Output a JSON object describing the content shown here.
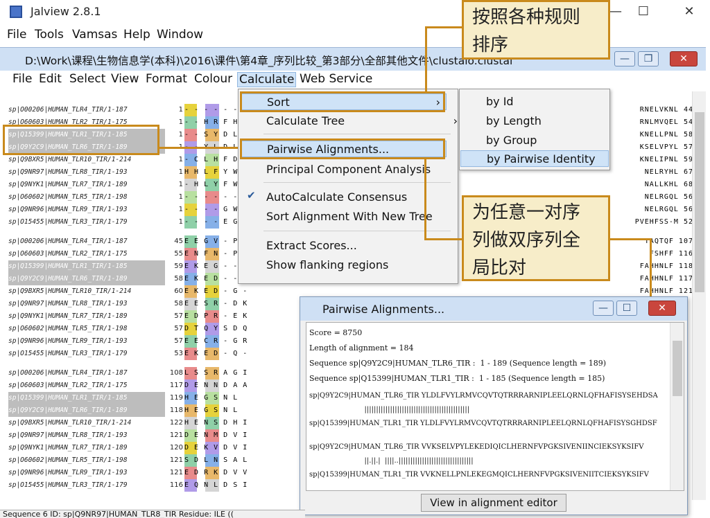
{
  "app": {
    "title": "Jalview 2.8.1",
    "min": "—",
    "max": "☐",
    "close": "✕"
  },
  "outer_menu": [
    "File",
    "Tools",
    "Vamsas",
    "Help",
    "Window"
  ],
  "inner_window": {
    "title": "D:\\Work\\课程\\生物信息学(本科)\\2016\\课件\\第4章_序列比较_第3部分\\全部其他文件\\clustalo.clustal"
  },
  "inner_menu": [
    "File",
    "Edit",
    "Select",
    "View",
    "Format",
    "Colour",
    "Calculate",
    "Web Service"
  ],
  "sequence_blocks": [
    {
      "names": [
        "sp|O00206|HUMAN_TLR4_TIR/1-187",
        "sp|O60603|HUMAN_TLR2_TIR/1-175",
        "sp|Q15399|HUMAN_TLR1_TIR/1-185",
        "sp|Q9Y2C9|HUMAN_TLR6_TIR/1-189",
        "sp|Q9BXR5|HUMAN_TLR10_TIR/1-214",
        "sp|Q9NR97|HUMAN_TLR8_TIR/1-193",
        "sp|Q9NYK1|HUMAN_TLR7_TIR/1-189",
        "sp|O60602|HUMAN_TLR5_TIR/1-198",
        "sp|Q9NR96|HUMAN_TLR9_TIR/1-193",
        "sp|O15455|HUMAN_TLR3_TIR/1-179"
      ],
      "starts": [
        "1",
        "1",
        "1",
        "1",
        "1",
        "1",
        "1",
        "1",
        "1",
        "1"
      ],
      "seqs": [
        "- - - - - - - -",
        "- - H R F H G L",
        "- - S Y D L F",
        "- - Y L D L F",
        "- C L H F D L",
        "H H L F Y W D",
        "- H L Y F W D",
        "- - - - - - - -",
        "- - - - G W D",
        "- - - - E G W R"
      ],
      "right": [
        "RNELVKNL 44",
        "RNLMVQEL 54",
        "KNELLPNL 58",
        "KSELVPYL 57",
        "KNELIPNL 59",
        "NELRYHL 67",
        "NALLKHL 68",
        "NELRGQL 56",
        "NELRGQL 56",
        "PVEHFSS-M 52"
      ]
    },
    {
      "names": [
        "sp|O00206|HUMAN_TLR4_TIR/1-187",
        "sp|O60603|HUMAN_TLR2_TIR/1-175",
        "sp|Q15399|HUMAN_TLR1_TIR/1-185",
        "sp|Q9Y2C9|HUMAN_TLR6_TIR/1-189",
        "sp|Q9BXR5|HUMAN_TLR10_TIR/1-214",
        "sp|Q9NR97|HUMAN_TLR8_TIR/1-193",
        "sp|Q9NYK1|HUMAN_TLR7_TIR/1-189",
        "sp|O60602|HUMAN_TLR5_TIR/1-198",
        "sp|Q9NR96|HUMAN_TLR9_TIR/1-193",
        "sp|O15455|HUMAN_TLR3_TIR/1-179"
      ],
      "starts": [
        "45",
        "55",
        "59",
        "58",
        "60",
        "58",
        "57",
        "57",
        "57",
        "53"
      ],
      "seqs": [
        "E E G V - P -",
        "E N F N - P -",
        "E K E G - - -",
        "E K E D - - -",
        "E K E D - G -",
        "E E S R - D K",
        "E D P R - E K",
        "D T Q Y S D Q",
        "E E C R - G R",
        "E K E D - Q -"
      ],
      "right": [
        "TAQTQF 107",
        "FSHFF 116",
        "FAHHNLF 118",
        "FAHHNLF 117",
        "FAHHNLF 121",
        "",
        "",
        "",
        "",
        ""
      ]
    },
    {
      "names": [
        "sp|O00206|HUMAN_TLR4_TIR/1-187",
        "sp|O60603|HUMAN_TLR2_TIR/1-175",
        "sp|Q15399|HUMAN_TLR1_TIR/1-185",
        "sp|Q9Y2C9|HUMAN_TLR6_TIR/1-189",
        "sp|Q9BXR5|HUMAN_TLR10_TIR/1-214",
        "sp|Q9NR97|HUMAN_TLR8_TIR/1-193",
        "sp|Q9NYK1|HUMAN_TLR7_TIR/1-189",
        "sp|O60602|HUMAN_TLR5_TIR/1-198",
        "sp|Q9NR96|HUMAN_TLR9_TIR/1-193",
        "sp|O15455|HUMAN_TLR3_TIR/1-179"
      ],
      "starts": [
        "108",
        "117",
        "119",
        "118",
        "122",
        "121",
        "120",
        "121",
        "121",
        "116"
      ],
      "seqs": [
        "L S S R A G I",
        "D E N N D A A",
        "H E G S N L",
        "H E G S N L",
        "H E N S D H I",
        "D E N M D V I",
        "D E K V D V I",
        "S D L N S A L",
        "E D R K D V V",
        "E Q N L D S I"
      ],
      "right": [
        "",
        "",
        "",
        "",
        "",
        "",
        "",
        "",
        "",
        ""
      ]
    }
  ],
  "calculate_menu": {
    "items": [
      {
        "label": "Sort",
        "arrow": "›"
      },
      {
        "label": "Calculate Tree",
        "arrow": "›"
      },
      {
        "label": "Pairwise Alignments..."
      },
      {
        "label": "Principal Component Analysis"
      },
      {
        "label": "AutoCalculate Consensus",
        "check": "✔"
      },
      {
        "label": "Sort Alignment With New Tree"
      },
      {
        "label": "Extract Scores..."
      },
      {
        "label": "Show flanking regions"
      }
    ]
  },
  "sort_submenu": [
    "by Id",
    "by Length",
    "by Group",
    "by Pairwise Identity"
  ],
  "annotations": {
    "sort_note_line1": "按照各种规则",
    "sort_note_line2": "排序",
    "pairwise_note_line1": "为任意一对序",
    "pairwise_note_line2": "列做双序列全",
    "pairwise_note_line3": "局比对"
  },
  "pairwise_window": {
    "title": "Pairwise Alignments...",
    "lines": [
      "Score = 8750",
      "Length of alignment = 184",
      "Sequence sp|Q9Y2C9|HUMAN_TLR6_TIR :  1 - 189 (Sequence length = 189)",
      "Sequence sp|Q15399|HUMAN_TLR1_TIR :  1 - 185 (Sequence length = 185)",
      "sp|Q9Y2C9|HUMAN_TLR6_TIR YLDLFVYLRMVCQVTQTRRRARNIPLEELQRNLQFHAFISYSEHDSA",
      "                         |||||||||||||||||||||||||||||||||||||||||||||",
      "sp|Q15399|HUMAN_TLR1_TIR YLDLFVYLRMVCQVTQTRRRARNIPLEELQRNLQFHAFISYSGHDSF",
      "sp|Q9Y2C9|HUMAN_TLR6_TIR VVKSELVPYLEKEDIQICLHERNFVPGKSIVENIINCIEKSYKSIFV",
      "                         ||.||.|  ||||..||||||||||||||||||||||||||||||||",
      "sp|Q15399|HUMAN_TLR1_TIR VVKNELLPNLEKEGMQICLHERNFVPGKSIVENIITCIEKSYKSIFV"
    ],
    "button": "View in alignment editor"
  },
  "status": "Sequence 6 ID: sp|Q9NR97|HUMAN_TLR8_TIR  Residue: ILE (("
}
